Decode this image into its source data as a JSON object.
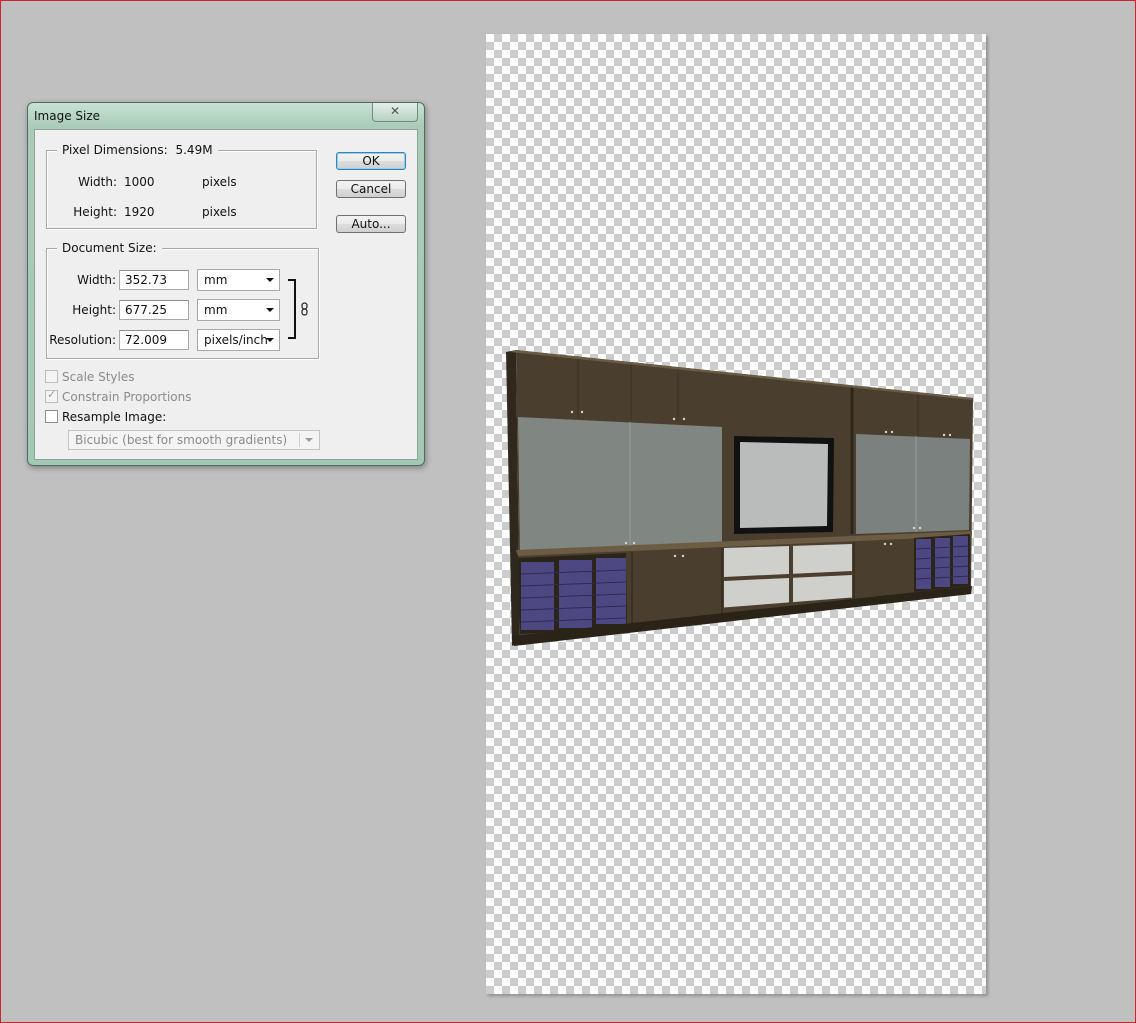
{
  "dialog": {
    "title": "Image Size",
    "close_glyph": "✕",
    "pixel_dimensions": {
      "legend": "Pixel Dimensions:",
      "size": "5.49M",
      "width_label": "Width:",
      "width_value": "1000",
      "width_unit": "pixels",
      "height_label": "Height:",
      "height_value": "1920",
      "height_unit": "pixels"
    },
    "document_size": {
      "legend": "Document Size:",
      "width_label": "Width:",
      "width_value": "352.73",
      "width_unit": "mm",
      "height_label": "Height:",
      "height_value": "677.25",
      "height_unit": "mm",
      "resolution_label": "Resolution:",
      "resolution_value": "72.009",
      "resolution_unit": "pixels/inch"
    },
    "options": {
      "scale_styles": "Scale Styles",
      "scale_styles_checked": false,
      "constrain": "Constrain Proportions",
      "constrain_checked": true,
      "resample": "Resample Image:",
      "resample_checked": false,
      "resample_method": "Bicubic (best for smooth gradients)"
    },
    "buttons": {
      "ok": "OK",
      "cancel": "Cancel",
      "auto": "Auto..."
    }
  },
  "canvas": {
    "content": "furniture-wall-unit-render",
    "background": "transparent-checkerboard"
  },
  "colors": {
    "workspace": "#c0c0c0",
    "wood": "#4a3f2e",
    "board": "#7f8582",
    "trays": "#4e4882",
    "dialog_frame": "#a9cbb8"
  }
}
